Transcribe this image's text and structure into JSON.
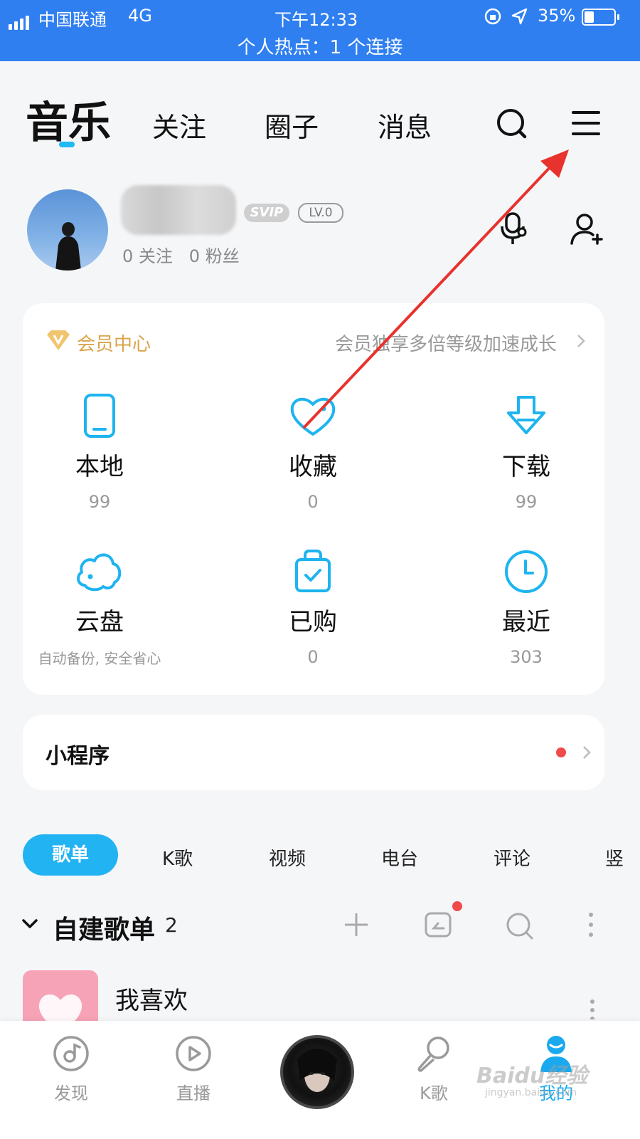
{
  "status_bar": {
    "carrier": "中国联通",
    "network": "4G",
    "time": "下午12:33",
    "battery": "35%",
    "hotspot": "个人热点：1 个连接"
  },
  "top_nav": {
    "tabs": [
      "音乐",
      "关注",
      "圈子",
      "消息"
    ],
    "active": "音乐",
    "icons": [
      "search-icon",
      "menu-icon"
    ]
  },
  "profile": {
    "badge_svip": "SVIP",
    "badge_level": "LV.0",
    "follows": "0 关注",
    "fans": "0 粉丝"
  },
  "vip": {
    "title": "会员中心",
    "desc": "会员独享多倍等级加速成长"
  },
  "grid": [
    {
      "label": "本地",
      "value": "99",
      "icon": "phone-icon"
    },
    {
      "label": "收藏",
      "value": "0",
      "icon": "heart-icon"
    },
    {
      "label": "下载",
      "value": "99",
      "icon": "download-icon"
    },
    {
      "label": "云盘",
      "value": "自动备份, 安全省心",
      "icon": "cloud-icon"
    },
    {
      "label": "已购",
      "value": "0",
      "icon": "bag-icon"
    },
    {
      "label": "最近",
      "value": "303",
      "icon": "clock-icon"
    }
  ],
  "mini_program": {
    "title": "小程序"
  },
  "content_tabs": [
    "歌单",
    "K歌",
    "视频",
    "电台",
    "评论",
    "竖"
  ],
  "playlist_section": {
    "title": "自建歌单",
    "count": "2",
    "items": [
      {
        "title": "我喜欢"
      }
    ]
  },
  "bottom_nav": [
    {
      "label": "发现",
      "icon": "discover-icon"
    },
    {
      "label": "直播",
      "icon": "live-icon"
    },
    {
      "label": "",
      "icon": "player-disc"
    },
    {
      "label": "K歌",
      "icon": "karaoke-icon"
    },
    {
      "label": "我的",
      "icon": "profile-icon"
    }
  ],
  "watermark": {
    "text": "Baidu经验",
    "url": "jingyan.baidu.com"
  },
  "colors": {
    "status_bar": "#2f7ff0",
    "accent": "#22b3f3",
    "annotation_arrow": "#e8322d",
    "vip_gold": "#d9a44a"
  }
}
